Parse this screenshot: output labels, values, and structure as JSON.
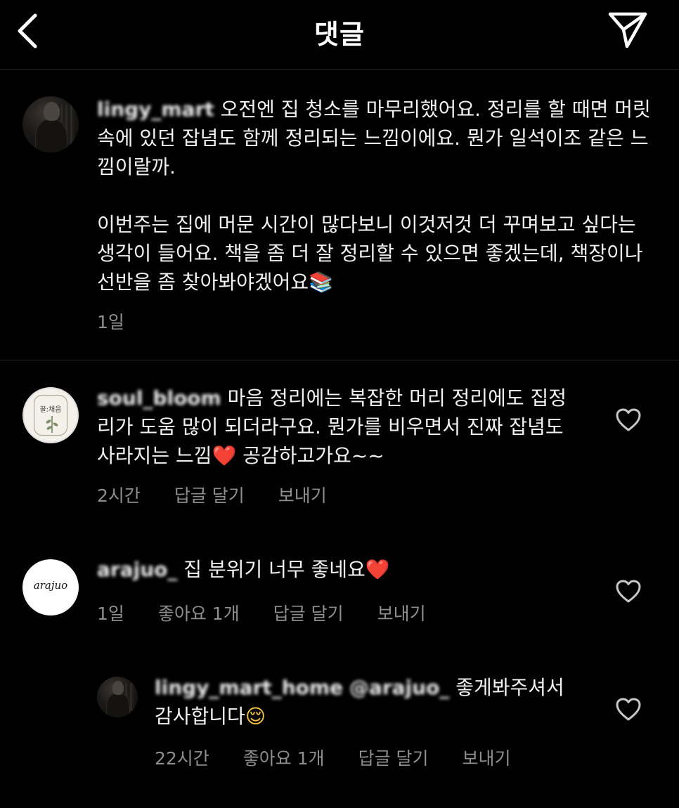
{
  "header": {
    "title": "댓글"
  },
  "caption": {
    "username": "lingy_mart",
    "paragraph1": "오전엔 집 청소를 마무리했어요. 정리를 할 때면 머릿속에 있던 잡념도 함께 정리되는 느낌이에요. 뭔가 일석이조 같은 느낌이랄까.",
    "paragraph2": "이번주는 집에 머문 시간이 많다보니 이것저것 더 꾸며보고 싶다는 생각이 들어요. 책을 좀 더 잘 정리할 수 있으면 좋겠는데, 책장이나 선반을 좀 찾아봐야겠어요",
    "paragraph2_emoji": "📚",
    "time": "1일"
  },
  "comments": [
    {
      "username": "soul_bloom",
      "avatar_text": "꿀:채움",
      "text_before_emoji": "마음 정리에는 복잡한 머리 정리에도 집정리가 도움 많이 되더라구요. 뭔가를 비우면서 진짜 잡념도 사라지는 느낌",
      "emoji": "❤️",
      "text_after_emoji": " 공감하고가요~~",
      "time": "2시간",
      "reply_label": "답글 달기",
      "send_label": "보내기",
      "heart_icon": "heart-outline"
    },
    {
      "username": "arajuo_",
      "avatar_text": "arajuo",
      "text_before_emoji": "집 분위기 너무 좋네요",
      "emoji": "❤️",
      "time": "1일",
      "likes": "좋아요 1개",
      "reply_label": "답글 달기",
      "send_label": "보내기",
      "heart_icon": "heart-outline"
    },
    {
      "username": "lingy_mart_home",
      "mention": "@arajuo_",
      "text_before_emoji": "좋게봐주셔서 감사합니다",
      "emoji": "😌",
      "time": "22시간",
      "likes": "좋아요 1개",
      "reply_label": "답글 달기",
      "send_label": "보내기",
      "heart_icon": "heart-outline"
    }
  ],
  "colors": {
    "background": "#000000",
    "text": "#f2f2f2",
    "meta": "#8e8e8e",
    "divider": "#262626",
    "heart_emoji": "#e0245e"
  }
}
